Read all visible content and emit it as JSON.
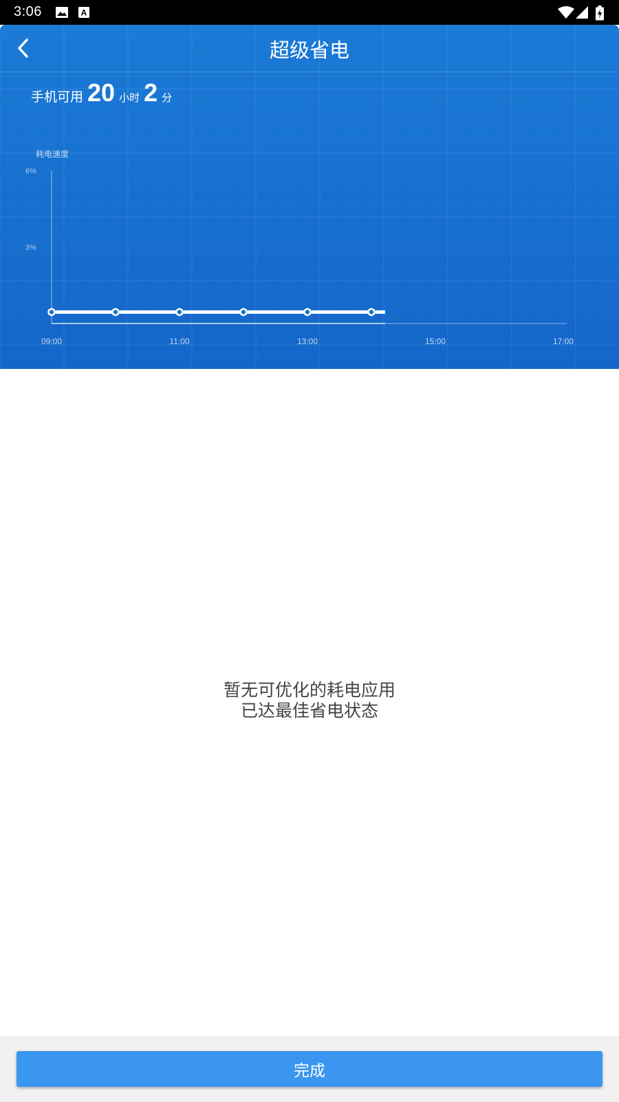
{
  "status_bar": {
    "time": "3:06",
    "icons": [
      "image-icon",
      "font-download-icon",
      "wifi-icon",
      "signal-icon",
      "battery-charging-icon"
    ]
  },
  "header": {
    "title": "超级省电",
    "back_icon": "chevron-left-icon",
    "available": {
      "label": "手机可用",
      "hours": "20",
      "hours_unit": "小时",
      "minutes": "2",
      "minutes_unit": "分"
    }
  },
  "chart_data": {
    "type": "line",
    "ylabel": "耗电速度",
    "yticks": [
      "6%",
      "3%"
    ],
    "xticks": [
      "09:00",
      "11:00",
      "13:00",
      "15:00",
      "17:00"
    ],
    "ylim": [
      0,
      6
    ],
    "x": [
      "09:00",
      "10:00",
      "11:00",
      "12:00",
      "13:00",
      "14:00"
    ],
    "values": [
      0.45,
      0.45,
      0.45,
      0.45,
      0.45,
      0.45
    ],
    "grid": true,
    "color": "#ffffff"
  },
  "message": {
    "line1": "暂无可优化的耗电应用",
    "line2": "已达最佳省电状态"
  },
  "footer": {
    "done_label": "完成"
  },
  "colors": {
    "header_blue": "#1a72d2",
    "button_blue": "#3a96ee",
    "message_text": "#444444"
  }
}
